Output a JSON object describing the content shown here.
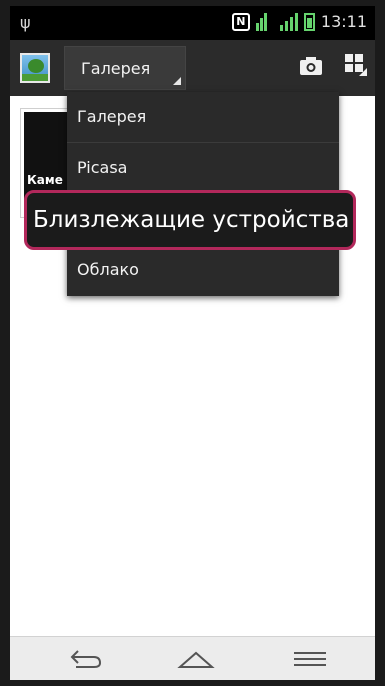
{
  "status_bar": {
    "time": "13:11",
    "icons": [
      "usb-icon",
      "nfc-icon",
      "wifi-icon",
      "signal-icon",
      "battery-icon"
    ]
  },
  "action_bar": {
    "spinner_label": "Галерея",
    "icons": [
      "app-icon",
      "camera-icon",
      "grid-view-icon"
    ]
  },
  "content": {
    "album_label": "Каме"
  },
  "dropdown": {
    "items": [
      "Галерея",
      "Picasa",
      "Близлежащие устройства",
      "Облако"
    ]
  },
  "nav_bar": {
    "icons": [
      "back-icon",
      "home-icon",
      "menu-icon"
    ]
  },
  "colors": {
    "status_accent": "#66d36e",
    "highlight_border": "#b2285b",
    "dropdown_bg": "#2a2a2a"
  }
}
